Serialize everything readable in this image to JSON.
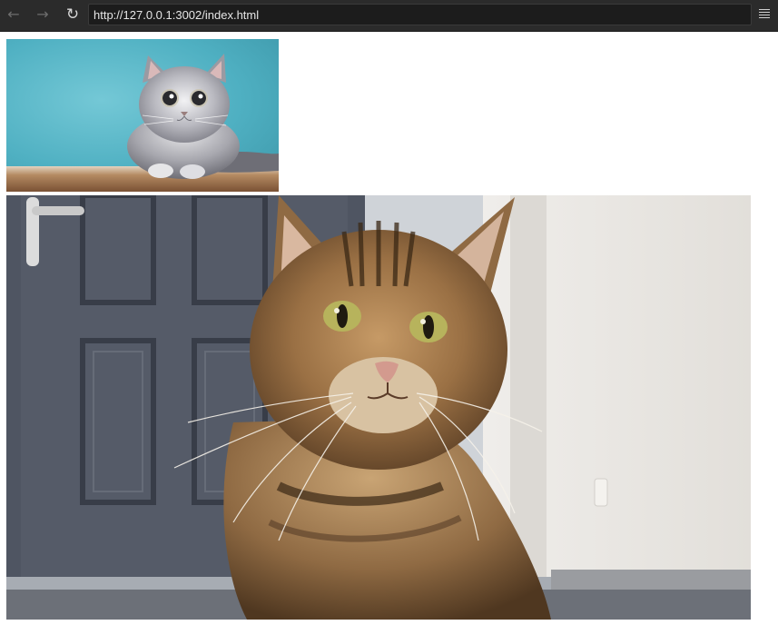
{
  "browser": {
    "url": "http://127.0.0.1:3002/index.html",
    "icons": {
      "back": "arrow-left-icon",
      "forward": "arrow-right-icon",
      "reload": "reload-icon",
      "menu": "hamburger-menu-icon"
    },
    "glyphs": {
      "back": "←",
      "forward": "→",
      "reload": "↻"
    }
  },
  "colors": {
    "toolbar_bg": "#2b2b2b",
    "urlbar_bg": "#1c1c1c",
    "page_bg": "#ffffff"
  }
}
